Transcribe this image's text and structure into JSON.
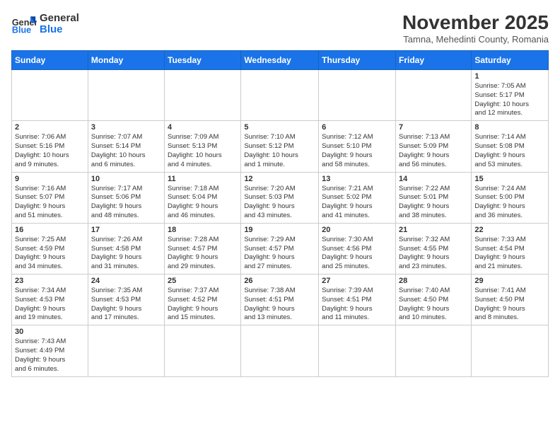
{
  "header": {
    "logo_general": "General",
    "logo_blue": "Blue",
    "month_title": "November 2025",
    "subtitle": "Tamna, Mehedinti County, Romania"
  },
  "weekdays": [
    "Sunday",
    "Monday",
    "Tuesday",
    "Wednesday",
    "Thursday",
    "Friday",
    "Saturday"
  ],
  "weeks": [
    [
      {
        "day": "",
        "info": ""
      },
      {
        "day": "",
        "info": ""
      },
      {
        "day": "",
        "info": ""
      },
      {
        "day": "",
        "info": ""
      },
      {
        "day": "",
        "info": ""
      },
      {
        "day": "",
        "info": ""
      },
      {
        "day": "1",
        "info": "Sunrise: 7:05 AM\nSunset: 5:17 PM\nDaylight: 10 hours\nand 12 minutes."
      }
    ],
    [
      {
        "day": "2",
        "info": "Sunrise: 7:06 AM\nSunset: 5:16 PM\nDaylight: 10 hours\nand 9 minutes."
      },
      {
        "day": "3",
        "info": "Sunrise: 7:07 AM\nSunset: 5:14 PM\nDaylight: 10 hours\nand 6 minutes."
      },
      {
        "day": "4",
        "info": "Sunrise: 7:09 AM\nSunset: 5:13 PM\nDaylight: 10 hours\nand 4 minutes."
      },
      {
        "day": "5",
        "info": "Sunrise: 7:10 AM\nSunset: 5:12 PM\nDaylight: 10 hours\nand 1 minute."
      },
      {
        "day": "6",
        "info": "Sunrise: 7:12 AM\nSunset: 5:10 PM\nDaylight: 9 hours\nand 58 minutes."
      },
      {
        "day": "7",
        "info": "Sunrise: 7:13 AM\nSunset: 5:09 PM\nDaylight: 9 hours\nand 56 minutes."
      },
      {
        "day": "8",
        "info": "Sunrise: 7:14 AM\nSunset: 5:08 PM\nDaylight: 9 hours\nand 53 minutes."
      }
    ],
    [
      {
        "day": "9",
        "info": "Sunrise: 7:16 AM\nSunset: 5:07 PM\nDaylight: 9 hours\nand 51 minutes."
      },
      {
        "day": "10",
        "info": "Sunrise: 7:17 AM\nSunset: 5:06 PM\nDaylight: 9 hours\nand 48 minutes."
      },
      {
        "day": "11",
        "info": "Sunrise: 7:18 AM\nSunset: 5:04 PM\nDaylight: 9 hours\nand 46 minutes."
      },
      {
        "day": "12",
        "info": "Sunrise: 7:20 AM\nSunset: 5:03 PM\nDaylight: 9 hours\nand 43 minutes."
      },
      {
        "day": "13",
        "info": "Sunrise: 7:21 AM\nSunset: 5:02 PM\nDaylight: 9 hours\nand 41 minutes."
      },
      {
        "day": "14",
        "info": "Sunrise: 7:22 AM\nSunset: 5:01 PM\nDaylight: 9 hours\nand 38 minutes."
      },
      {
        "day": "15",
        "info": "Sunrise: 7:24 AM\nSunset: 5:00 PM\nDaylight: 9 hours\nand 36 minutes."
      }
    ],
    [
      {
        "day": "16",
        "info": "Sunrise: 7:25 AM\nSunset: 4:59 PM\nDaylight: 9 hours\nand 34 minutes."
      },
      {
        "day": "17",
        "info": "Sunrise: 7:26 AM\nSunset: 4:58 PM\nDaylight: 9 hours\nand 31 minutes."
      },
      {
        "day": "18",
        "info": "Sunrise: 7:28 AM\nSunset: 4:57 PM\nDaylight: 9 hours\nand 29 minutes."
      },
      {
        "day": "19",
        "info": "Sunrise: 7:29 AM\nSunset: 4:57 PM\nDaylight: 9 hours\nand 27 minutes."
      },
      {
        "day": "20",
        "info": "Sunrise: 7:30 AM\nSunset: 4:56 PM\nDaylight: 9 hours\nand 25 minutes."
      },
      {
        "day": "21",
        "info": "Sunrise: 7:32 AM\nSunset: 4:55 PM\nDaylight: 9 hours\nand 23 minutes."
      },
      {
        "day": "22",
        "info": "Sunrise: 7:33 AM\nSunset: 4:54 PM\nDaylight: 9 hours\nand 21 minutes."
      }
    ],
    [
      {
        "day": "23",
        "info": "Sunrise: 7:34 AM\nSunset: 4:53 PM\nDaylight: 9 hours\nand 19 minutes."
      },
      {
        "day": "24",
        "info": "Sunrise: 7:35 AM\nSunset: 4:53 PM\nDaylight: 9 hours\nand 17 minutes."
      },
      {
        "day": "25",
        "info": "Sunrise: 7:37 AM\nSunset: 4:52 PM\nDaylight: 9 hours\nand 15 minutes."
      },
      {
        "day": "26",
        "info": "Sunrise: 7:38 AM\nSunset: 4:51 PM\nDaylight: 9 hours\nand 13 minutes."
      },
      {
        "day": "27",
        "info": "Sunrise: 7:39 AM\nSunset: 4:51 PM\nDaylight: 9 hours\nand 11 minutes."
      },
      {
        "day": "28",
        "info": "Sunrise: 7:40 AM\nSunset: 4:50 PM\nDaylight: 9 hours\nand 10 minutes."
      },
      {
        "day": "29",
        "info": "Sunrise: 7:41 AM\nSunset: 4:50 PM\nDaylight: 9 hours\nand 8 minutes."
      }
    ],
    [
      {
        "day": "30",
        "info": "Sunrise: 7:43 AM\nSunset: 4:49 PM\nDaylight: 9 hours\nand 6 minutes."
      },
      {
        "day": "",
        "info": ""
      },
      {
        "day": "",
        "info": ""
      },
      {
        "day": "",
        "info": ""
      },
      {
        "day": "",
        "info": ""
      },
      {
        "day": "",
        "info": ""
      },
      {
        "day": "",
        "info": ""
      }
    ]
  ]
}
